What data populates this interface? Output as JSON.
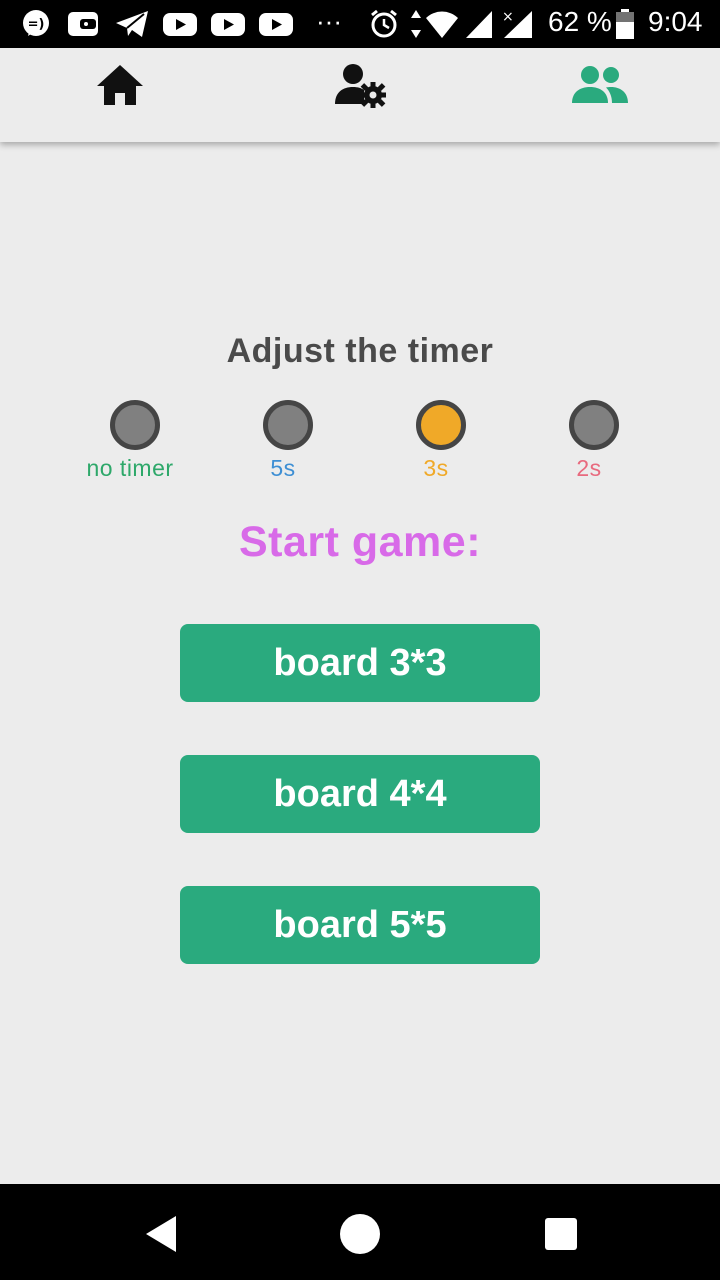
{
  "status_bar": {
    "battery_percent": "62 %",
    "time": "9:04",
    "overflow": "···",
    "icons": [
      "messenger-icon",
      "wallet-icon",
      "telegram-icon",
      "youtube-icon",
      "youtube-icon",
      "youtube-icon",
      "alarm-icon",
      "wifi-icon",
      "signal-icon",
      "signal-no-service-icon",
      "battery-icon"
    ]
  },
  "top_nav": {
    "items": [
      {
        "icon": "home-icon",
        "active": false
      },
      {
        "icon": "user-settings-icon",
        "active": false
      },
      {
        "icon": "people-icon",
        "active": true
      }
    ],
    "active_color": "#2aaa7e"
  },
  "timer": {
    "title": "Adjust the timer",
    "options": [
      {
        "label": "no timer",
        "color": "#2ea86a",
        "selected": false
      },
      {
        "label": "5s",
        "color": "#3e8fd4",
        "selected": false
      },
      {
        "label": "3s",
        "color": "#f0a928",
        "selected": true
      },
      {
        "label": "2s",
        "color": "#e86a7e",
        "selected": false
      }
    ]
  },
  "start": {
    "label": "Start game:",
    "color": "#d86ae8"
  },
  "boards": [
    {
      "label": "board 3*3"
    },
    {
      "label": "board 4*4"
    },
    {
      "label": "board 5*5"
    }
  ],
  "button_color": "#2aaa7e",
  "android_nav": [
    "back-icon",
    "home-circle-icon",
    "recents-icon"
  ]
}
